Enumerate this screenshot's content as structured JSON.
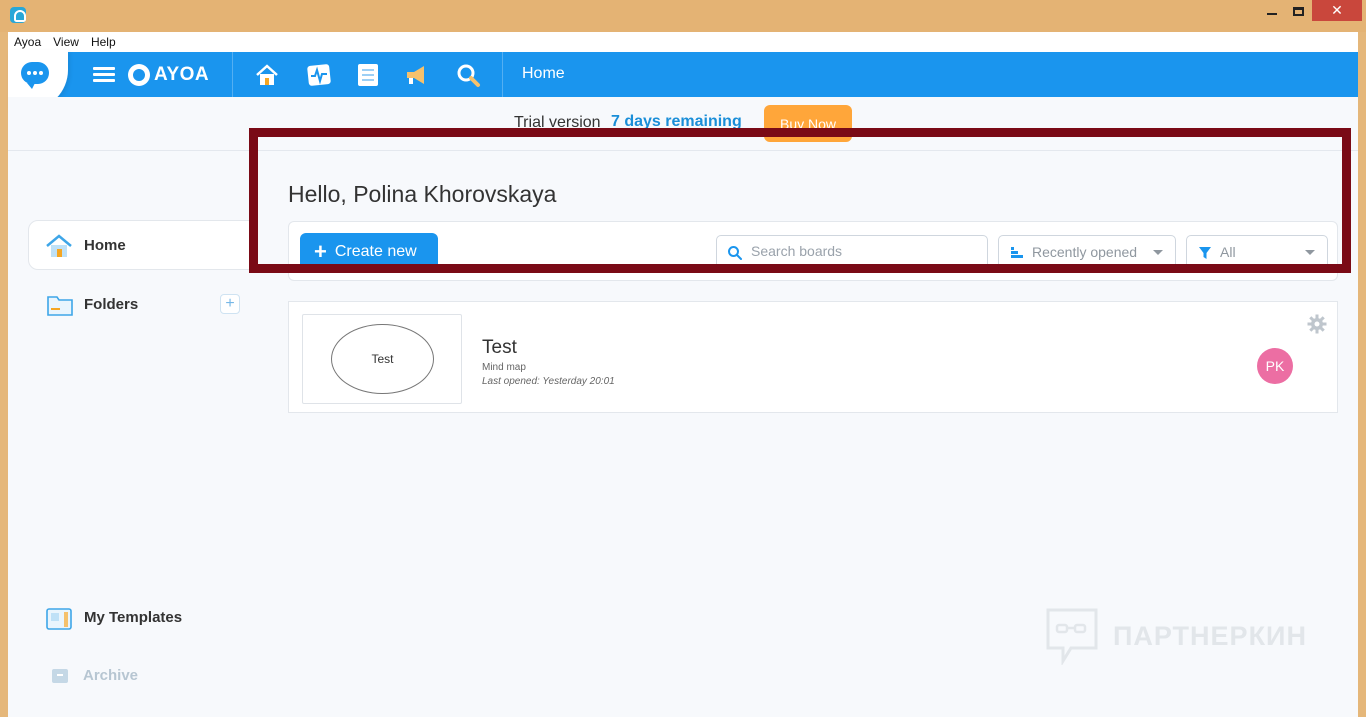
{
  "window": {
    "close_glyph": "✕"
  },
  "menubar": {
    "items": [
      "Ayoa",
      "View",
      "Help"
    ]
  },
  "appbar": {
    "logo_text": "AYOA",
    "title": "Home",
    "nav_icons": [
      "home-icon",
      "activity-icon",
      "tasks-icon",
      "announcement-icon",
      "search-icon"
    ],
    "accent": "#1a95ee"
  },
  "trial": {
    "label": "Trial version",
    "days": "7 days remaining",
    "buy_label": "Buy Now",
    "buy_color": "#ffa63a"
  },
  "greeting": "Hello, Polina Khorovskaya",
  "sidebar": {
    "home_label": "Home",
    "folders_label": "Folders",
    "add_glyph": "+",
    "templates_label": "My Templates",
    "archive_label": "Archive"
  },
  "toolbar": {
    "create_label": "Create new",
    "create_glyph": "+",
    "search_placeholder": "Search boards",
    "sort_label": "Recently opened",
    "filter_label": "All"
  },
  "boards": [
    {
      "thumb_node": "Test",
      "title": "Test",
      "type": "Mind map",
      "last_opened": "Last opened: Yesterday 20:01",
      "owner_initials": "PK",
      "owner_color": "#ec6ea3"
    }
  ],
  "watermark": "ПАРТНЕРКИН",
  "highlight_color": "#7a0a16"
}
